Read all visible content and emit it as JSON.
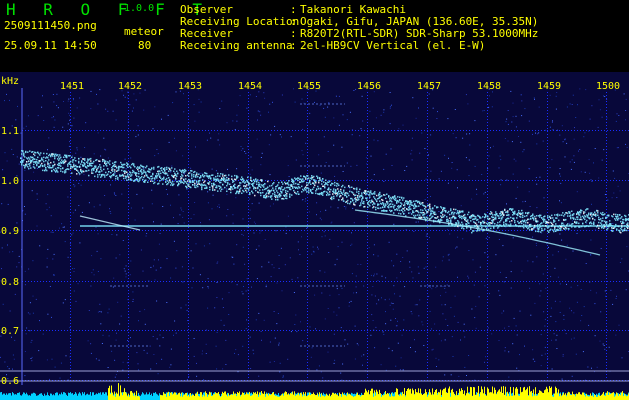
{
  "header": {
    "brand": "H R O F F T",
    "version": "1.0.0",
    "filename": "2509111450.png",
    "mode": "meteor",
    "timestamp": "25.09.11 14:50",
    "count": "80",
    "info": [
      {
        "label": "Observer",
        "value": "Takanori Kawachi"
      },
      {
        "label": "Receiving Location",
        "value": "Ogaki, Gifu, JAPAN (136.60E, 35.35N)"
      },
      {
        "label": "Receiver",
        "value": "R820T2(RTL-SDR) SDR-Sharp 53.1000MHz"
      },
      {
        "label": "Receiving antenna",
        "value": "2el-HB9CV Vertical (el. E-W)"
      }
    ]
  },
  "spectrogram": {
    "y_unit": "kHz",
    "y_ticks": [
      "1.1",
      "1.0",
      "0.9",
      "0.8",
      "0.7",
      "0.6"
    ],
    "x_ticks": [
      "1451",
      "1452",
      "1453",
      "1454",
      "1455",
      "1456",
      "1457",
      "1458",
      "1459",
      "1500"
    ],
    "colors": {
      "background": "#08083a",
      "grid": "#1a2cff",
      "tick_label": "#ffff00",
      "trace": "#7fe8ff",
      "trace_hot": "#ffffff",
      "bars_cyan": "#00d0ff",
      "bars_yellow": "#ffff00"
    }
  }
}
